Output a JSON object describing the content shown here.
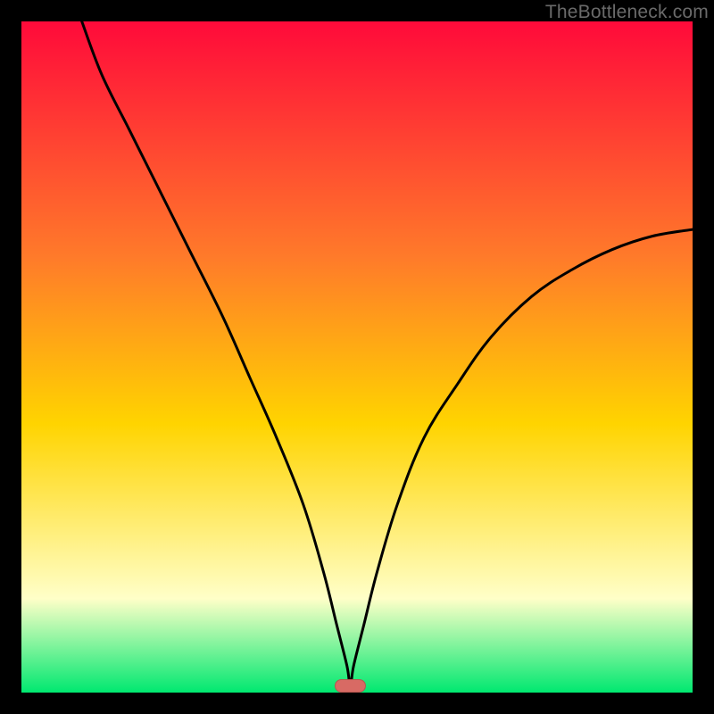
{
  "watermark": "TheBottleneck.com",
  "colors": {
    "frame": "#000000",
    "gradient_top": "#ff0a3a",
    "gradient_mid_upper": "#ff7a2a",
    "gradient_mid": "#ffd400",
    "gradient_pale": "#ffffc8",
    "gradient_green": "#00e870",
    "curve": "#000000",
    "marker_fill": "#d86a64",
    "marker_stroke": "#b85650"
  },
  "chart_data": {
    "type": "line",
    "title": "",
    "xlabel": "",
    "ylabel": "",
    "xlim": [
      0,
      100
    ],
    "ylim": [
      0,
      100
    ],
    "grid": false,
    "notes": "V-shaped bottleneck curve. Vertical axis = mismatch severity (0 at bottom/green, 100 at top/red). Horizontal axis = relative component balance (%). Minimum near x≈49. Background is a vertical gradient red→orange→yellow→pale→green (top→bottom).",
    "minimum_marker": {
      "x": 49,
      "y": 1
    },
    "series": [
      {
        "name": "bottleneck-curve",
        "x": [
          9,
          12,
          16,
          20,
          25,
          30,
          34,
          38,
          42,
          45,
          47,
          48.5,
          49,
          49.5,
          51,
          53,
          56,
          60,
          65,
          70,
          76,
          82,
          88,
          94,
          100
        ],
        "y": [
          100,
          92,
          84,
          76,
          66,
          56,
          47,
          38,
          28,
          18,
          10,
          4,
          1,
          4,
          10,
          18,
          28,
          38,
          46,
          53,
          59,
          63,
          66,
          68,
          69
        ]
      }
    ]
  }
}
